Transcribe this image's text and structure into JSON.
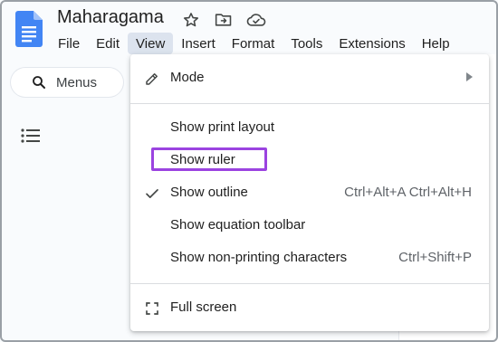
{
  "document": {
    "title": "Maharagama"
  },
  "header_icons": [
    "star-icon",
    "move-to-folder-icon",
    "cloud-saved-icon"
  ],
  "menubar": {
    "items": [
      {
        "name": "file",
        "label": "File"
      },
      {
        "name": "edit",
        "label": "Edit"
      },
      {
        "name": "view",
        "label": "View"
      },
      {
        "name": "insert",
        "label": "Insert"
      },
      {
        "name": "format",
        "label": "Format"
      },
      {
        "name": "tools",
        "label": "Tools"
      },
      {
        "name": "extensions",
        "label": "Extensions"
      },
      {
        "name": "help",
        "label": "Help"
      }
    ],
    "active": "View"
  },
  "sidebar": {
    "menus_label": "Menus"
  },
  "view_menu": {
    "mode": {
      "label": "Mode"
    },
    "show_print_layout": {
      "label": "Show print layout"
    },
    "show_ruler": {
      "label": "Show ruler"
    },
    "show_outline": {
      "label": "Show outline",
      "shortcut": "Ctrl+Alt+A Ctrl+Alt+H",
      "checked": true
    },
    "show_equation_toolbar": {
      "label": "Show equation toolbar"
    },
    "show_non_printing": {
      "label": "Show non-printing characters",
      "shortcut": "Ctrl+Shift+P"
    },
    "full_screen": {
      "label": "Full screen"
    }
  },
  "colors": {
    "highlight_box": "#9b43e0",
    "docs_blue": "#4285f4",
    "active_menu_bg": "#dce3ee"
  }
}
